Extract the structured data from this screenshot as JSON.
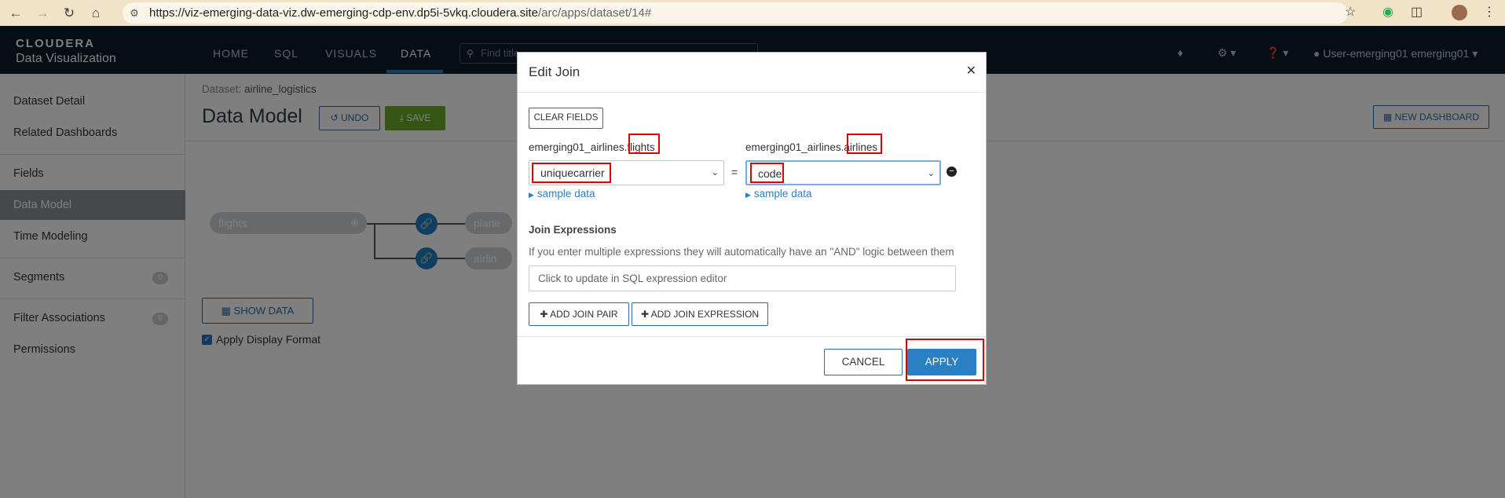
{
  "browser": {
    "url_main": "https://viz-emerging-data-viz.dw-emerging-cdp-env.dp5i-5vkq.cloudera.site",
    "url_path": "/arc/apps/dataset/14#"
  },
  "app": {
    "brand": "CLOUDERA",
    "product": "Data Visualization",
    "nav": [
      "HOME",
      "SQL",
      "VISUALS",
      "DATA"
    ],
    "active_nav": "DATA",
    "find_placeholder": "Find title",
    "user": "User-emerging01 emerging01"
  },
  "sidebar": {
    "items": [
      {
        "label": "Dataset Detail"
      },
      {
        "label": "Related Dashboards"
      },
      {
        "label": "Fields"
      },
      {
        "label": "Data Model"
      },
      {
        "label": "Time Modeling"
      },
      {
        "label": "Segments",
        "badge": "0"
      },
      {
        "label": "Filter Associations",
        "badge": "0"
      },
      {
        "label": "Permissions"
      }
    ],
    "active": "Data Model"
  },
  "main": {
    "dataset_prefix": "Dataset:",
    "dataset_name": "airline_logistics",
    "title": "Data Model",
    "undo_label": "UNDO",
    "save_label": "SAVE",
    "new_dashboard_label": "NEW DASHBOARD",
    "tables": {
      "root": "flights",
      "child1": "plane",
      "child2": "airlin"
    },
    "show_data_label": "SHOW DATA",
    "apply_format_label": "Apply Display Format"
  },
  "modal": {
    "title": "Edit Join",
    "clear_fields_label": "CLEAR FIELDS",
    "left_schema": "emerging01_airlines.",
    "left_table": "flights",
    "right_schema": "emerging01_airlines.",
    "right_table": "airlines",
    "left_field": "uniquecarrier",
    "right_field": "code",
    "equals": "=",
    "sample_data_label": "sample data",
    "join_expressions_title": "Join Expressions",
    "join_expressions_help": "If you enter multiple expressions they will automatically have an \"AND\" logic between them",
    "sql_placeholder": "Click to update in SQL expression editor",
    "add_join_pair_label": "ADD JOIN PAIR",
    "add_join_expression_label": "ADD JOIN EXPRESSION",
    "cancel_label": "CANCEL",
    "apply_label": "APPLY"
  },
  "colors": {
    "header_bg": "#0d1c2a",
    "accent": "#2b80c4",
    "save_green": "#6aab2b",
    "highlight_red": "#e00000"
  }
}
